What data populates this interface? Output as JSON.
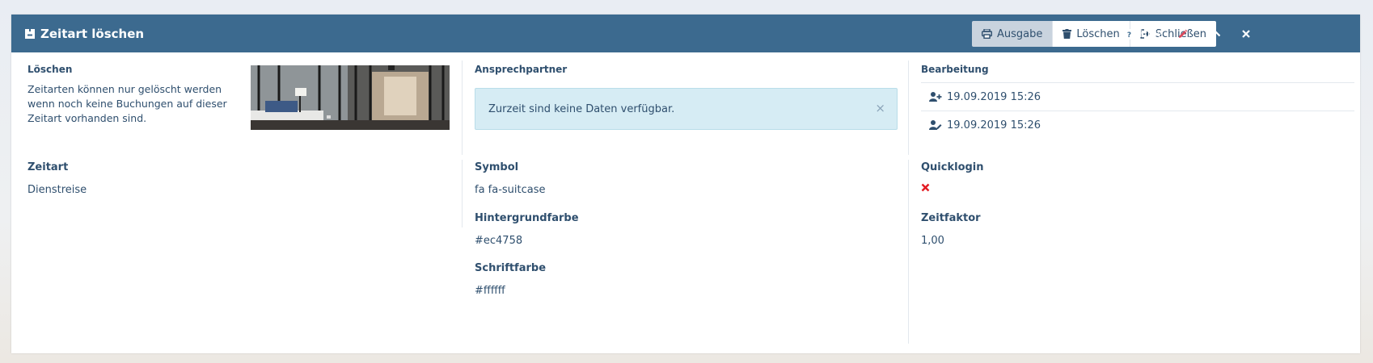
{
  "header": {
    "title": "Zeitart löschen",
    "title_icon": "box-minus-icon",
    "buttons": [
      {
        "label": "Ausgabe",
        "icon": "printer-icon",
        "active": true
      },
      {
        "label": "Löschen",
        "icon": "trash-icon",
        "active": false
      },
      {
        "label": "Schließen",
        "icon": "sign-out-icon",
        "active": false
      }
    ],
    "help_label": "Hilfe",
    "accent_pencil_color": "#d9485a",
    "bg_color": "#3c6a8f"
  },
  "delete_section": {
    "label": "Löschen",
    "description": "Zeitarten können nur gelöscht werden wenn noch keine Buchungen auf dieser Zeitart vorhanden sind."
  },
  "contact_section": {
    "label": "Ansprechpartner",
    "alert_text": "Zurzeit sind keine Daten verfügbar."
  },
  "edit_section": {
    "label": "Bearbeitung",
    "created": "19.09.2019 15:26",
    "modified": "19.09.2019 15:26"
  },
  "fields": {
    "zeitart_label": "Zeitart",
    "zeitart_value": "Dienstreise",
    "symbol_label": "Symbol",
    "symbol_value": "fa fa-suitcase",
    "bg_color_label": "Hintergrundfarbe",
    "bg_color_value": "#ec4758",
    "font_color_label": "Schriftfarbe",
    "font_color_value": "#ffffff",
    "quicklogin_label": "Quicklogin",
    "quicklogin_value_icon": "cross-icon",
    "zeitfaktor_label": "Zeitfaktor",
    "zeitfaktor_value": "1,00"
  }
}
